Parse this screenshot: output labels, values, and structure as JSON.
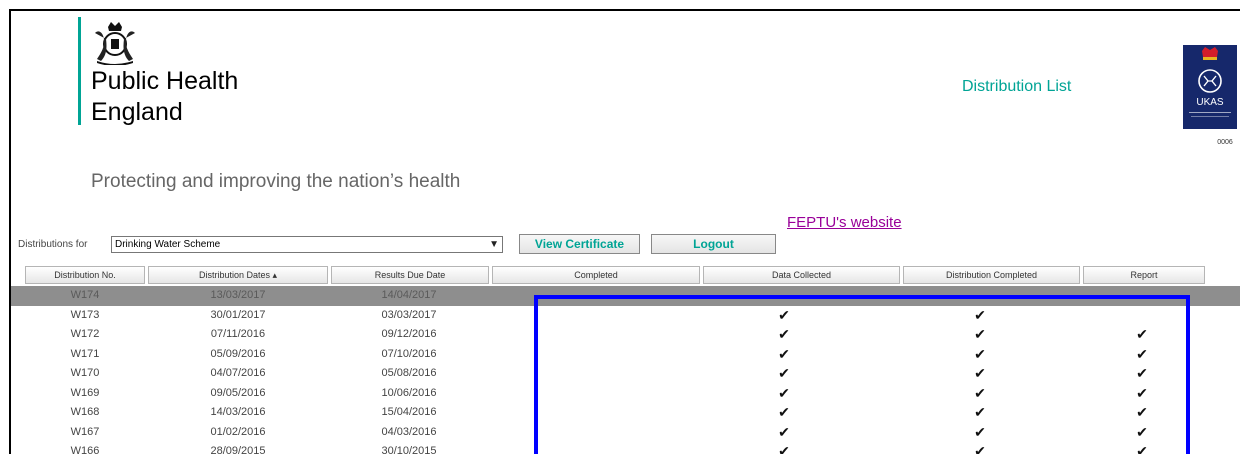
{
  "header": {
    "org_name_line1": "Public Health",
    "org_name_line2": "England",
    "tagline": "Protecting and improving the nation’s health",
    "page_title": "Distribution List",
    "website_link": "FEPTU's website",
    "ukas_text": "UKAS",
    "ukas_number": "0006"
  },
  "controls": {
    "distributions_for_label": "Distributions for",
    "scheme_selected": "Drinking Water Scheme",
    "view_certificate_label": "View Certificate",
    "logout_label": "Logout"
  },
  "table": {
    "columns": [
      "Distribution No.",
      "Distribution Dates ▴",
      "Results Due Date",
      "Completed",
      "Data Collected",
      "Distribution Completed",
      "Report"
    ],
    "rows": [
      {
        "no": "W174",
        "dates": "13/03/2017",
        "due": "14/04/2017",
        "completed": "",
        "data_collected": "",
        "dist_completed": "",
        "report": ""
      },
      {
        "no": "W173",
        "dates": "30/01/2017",
        "due": "03/03/2017",
        "completed": "",
        "data_collected": "✔",
        "dist_completed": "✔",
        "report": ""
      },
      {
        "no": "W172",
        "dates": "07/11/2016",
        "due": "09/12/2016",
        "completed": "",
        "data_collected": "✔",
        "dist_completed": "✔",
        "report": "✔"
      },
      {
        "no": "W171",
        "dates": "05/09/2016",
        "due": "07/10/2016",
        "completed": "",
        "data_collected": "✔",
        "dist_completed": "✔",
        "report": "✔"
      },
      {
        "no": "W170",
        "dates": "04/07/2016",
        "due": "05/08/2016",
        "completed": "",
        "data_collected": "✔",
        "dist_completed": "✔",
        "report": "✔"
      },
      {
        "no": "W169",
        "dates": "09/05/2016",
        "due": "10/06/2016",
        "completed": "",
        "data_collected": "✔",
        "dist_completed": "✔",
        "report": "✔"
      },
      {
        "no": "W168",
        "dates": "14/03/2016",
        "due": "15/04/2016",
        "completed": "",
        "data_collected": "✔",
        "dist_completed": "✔",
        "report": "✔"
      },
      {
        "no": "W167",
        "dates": "01/02/2016",
        "due": "04/03/2016",
        "completed": "",
        "data_collected": "✔",
        "dist_completed": "✔",
        "report": "✔"
      },
      {
        "no": "W166",
        "dates": "28/09/2015",
        "due": "30/10/2015",
        "completed": "",
        "data_collected": "✔",
        "dist_completed": "✔",
        "report": "✔"
      }
    ]
  },
  "colors": {
    "phe_teal": "#00a495",
    "link_purple": "#990099",
    "highlight_blue": "#0000ff",
    "selected_row": "#8e8e8e"
  },
  "icons": [
    "royal-crest-icon",
    "ukas-badge-icon",
    "chevron-down-icon",
    "checkmark-icon"
  ]
}
